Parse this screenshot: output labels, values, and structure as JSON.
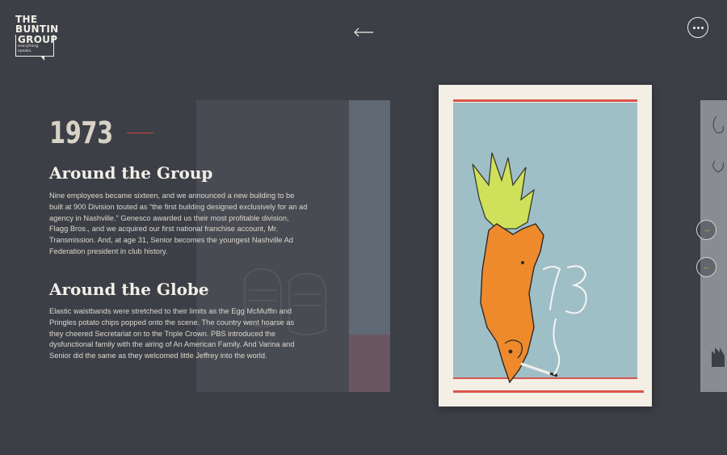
{
  "brand": {
    "line1": "THE",
    "line2": "BUNTIN",
    "line3": "GROUP",
    "tagline": "everything speaks."
  },
  "nav": {
    "back_symbol": "←",
    "menu_icon": "ellipsis-icon",
    "next_symbol": "→",
    "prev_symbol": "←"
  },
  "timeline": {
    "year": "1973",
    "sections": [
      {
        "title": "Around the Group",
        "body": "Nine employees became sixteen, and we announced a new building to be built at 900 Division touted as “the first building designed exclusively for an ad agency in Nashville.” Genesco awarded us their most profitable division, Flagg Bros., and we acquired our first national franchise account, Mr. Transmission. And, at age 31, Senior becomes the youngest Nashville Ad Federation president in club history."
      },
      {
        "title": "Around the Globe",
        "body": "Elastic waistbands were stretched to their limits as the Egg McMuffin and Pringles potato chips popped onto the scene. The country went hoarse as they cheered Secretariat on to the Triple Crown. PBS introduced the dysfunctional family with the airing of An American Family. And Varina and Senior did the same as they welcomed little Jeffrey into the world."
      }
    ]
  },
  "poster": {
    "numeral": "73"
  },
  "colors": {
    "background": "#3d3f47",
    "accent_red": "#c8453c",
    "accent_gold": "#e1b93c",
    "poster_sky": "#9fbfc7"
  }
}
